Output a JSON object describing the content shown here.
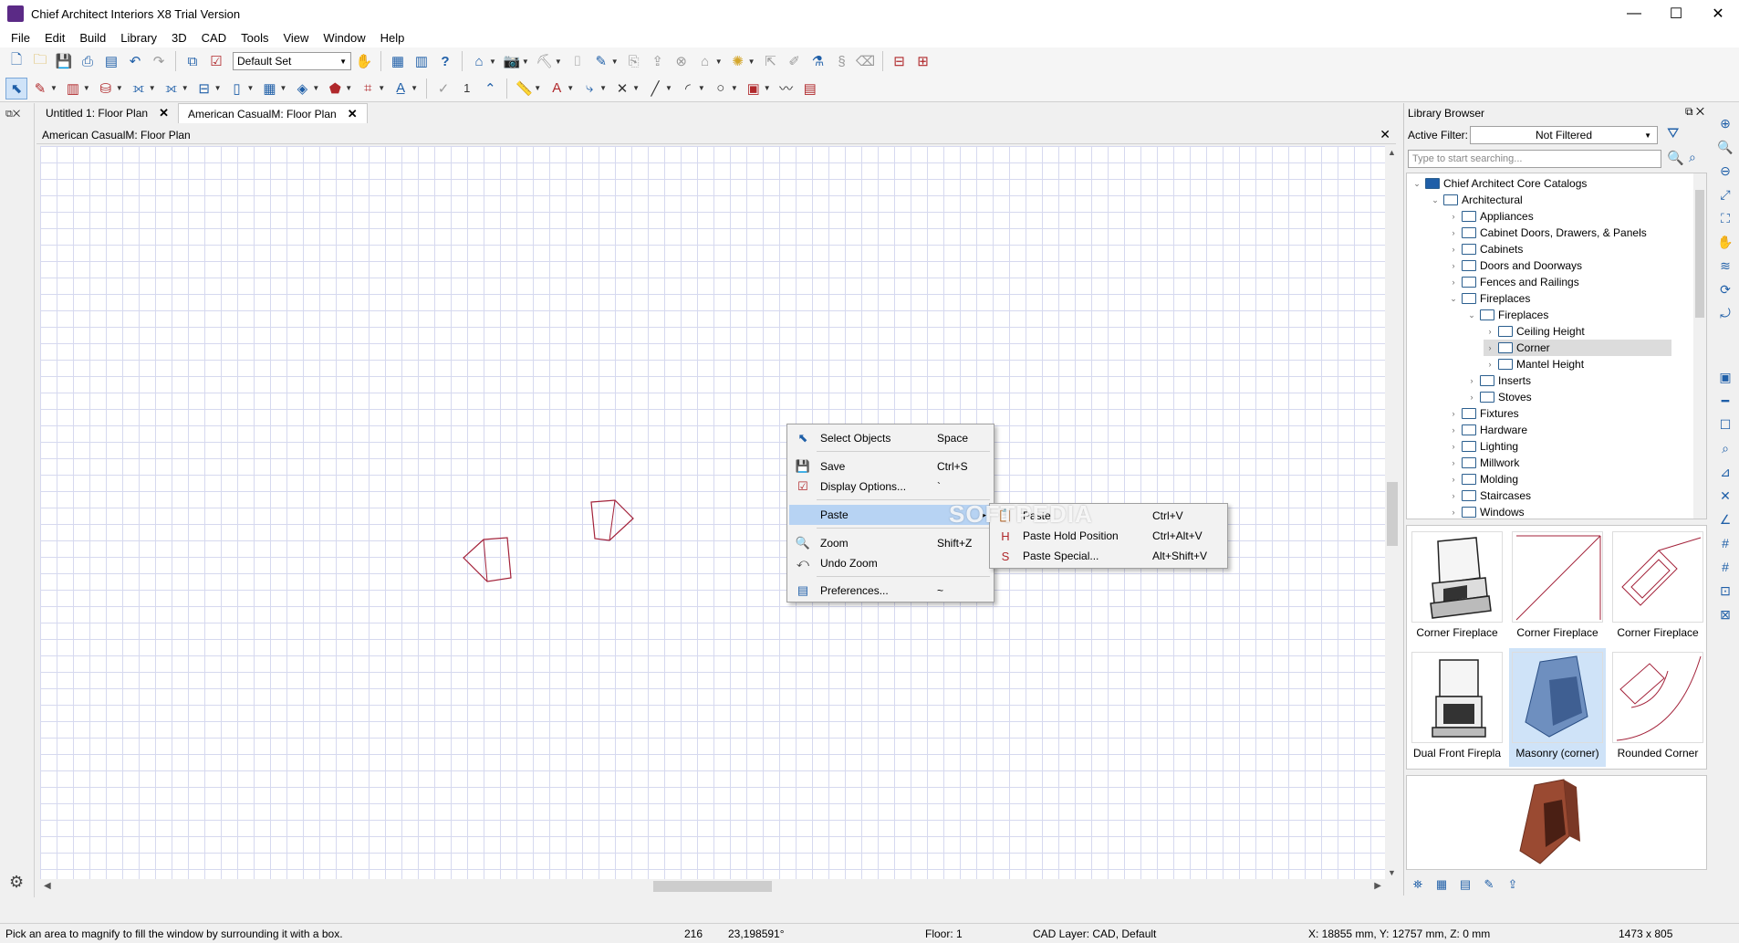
{
  "window": {
    "title": "Chief Architect Interiors X8 Trial Version",
    "minimize": "—",
    "maximize": "☐",
    "close": "✕"
  },
  "menu": [
    "File",
    "Edit",
    "Build",
    "Library",
    "3D",
    "CAD",
    "Tools",
    "View",
    "Window",
    "Help"
  ],
  "toolbar": {
    "layer_set": "Default Set",
    "number_field": "1"
  },
  "tabs": [
    {
      "label": "Untitled 1: Floor Plan",
      "close": "✕"
    },
    {
      "label": "American CasualM: Floor Plan",
      "close": "✕"
    }
  ],
  "view": {
    "header": "American CasualM: Floor Plan",
    "close": "✕"
  },
  "context_menu": {
    "items": [
      {
        "label": "Select Objects",
        "shortcut": "Space",
        "icon": "select-objects-icon"
      },
      {
        "label": "Save",
        "shortcut": "Ctrl+S",
        "icon": "save-icon"
      },
      {
        "label": "Display Options...",
        "shortcut": "`",
        "icon": "display-options-icon"
      },
      {
        "label": "Paste",
        "shortcut": "",
        "icon": "",
        "arrow": "▸"
      },
      {
        "label": "Zoom",
        "shortcut": "Shift+Z",
        "icon": "zoom-icon"
      },
      {
        "label": "Undo Zoom",
        "shortcut": "",
        "icon": "undo-zoom-icon"
      },
      {
        "label": "Preferences...",
        "shortcut": "~",
        "icon": "preferences-icon"
      }
    ],
    "submenu": [
      {
        "label": "Paste",
        "shortcut": "Ctrl+V"
      },
      {
        "label": "Paste Hold Position",
        "shortcut": "Ctrl+Alt+V"
      },
      {
        "label": "Paste Special...",
        "shortcut": "Alt+Shift+V"
      }
    ],
    "watermark": "SOFTPEDIA"
  },
  "library": {
    "title": "Library Browser",
    "filter_label": "Active Filter:",
    "filter_value": "Not Filtered",
    "search_placeholder": "Type to start searching...",
    "tree": [
      {
        "label": "Chief Architect Core Catalogs",
        "expanded": "⌄"
      },
      {
        "label": "Architectural",
        "expanded": "⌄"
      },
      {
        "label": "Appliances",
        "expanded": "›"
      },
      {
        "label": "Cabinet Doors, Drawers, & Panels",
        "expanded": "›"
      },
      {
        "label": "Cabinets",
        "expanded": "›"
      },
      {
        "label": "Doors and Doorways",
        "expanded": "›"
      },
      {
        "label": "Fences and Railings",
        "expanded": "›"
      },
      {
        "label": "Fireplaces",
        "expanded": "⌄"
      },
      {
        "label": "Fireplaces",
        "expanded": "⌄"
      },
      {
        "label": "Ceiling Height",
        "expanded": "›"
      },
      {
        "label": "Corner",
        "expanded": "›"
      },
      {
        "label": "Mantel Height",
        "expanded": "›"
      },
      {
        "label": "Inserts",
        "expanded": "›"
      },
      {
        "label": "Stoves",
        "expanded": "›"
      },
      {
        "label": "Fixtures",
        "expanded": "›"
      },
      {
        "label": "Hardware",
        "expanded": "›"
      },
      {
        "label": "Lighting",
        "expanded": "›"
      },
      {
        "label": "Millwork",
        "expanded": "›"
      },
      {
        "label": "Molding",
        "expanded": "›"
      },
      {
        "label": "Staircases",
        "expanded": "›"
      },
      {
        "label": "Windows",
        "expanded": "›"
      }
    ],
    "thumbnails": [
      "Corner Fireplace",
      "Corner Fireplace",
      "Corner Fireplace",
      "Dual Front Firepla",
      "Masonry (corner)",
      "Rounded Corner"
    ]
  },
  "status": {
    "message": "Pick an area to magnify to fill the window by surrounding it with a box.",
    "count": "216",
    "angle": "23,198591°",
    "floor": "Floor: 1",
    "cad_layer": "CAD Layer: CAD,  Default",
    "coords": "X: 18855 mm, Y: 12757 mm, Z: 0 mm",
    "size": "1473 x 805"
  },
  "colors": {
    "accent": "#1f5fa8",
    "highlight": "#b7d3f3",
    "drawing_line": "#a3223a",
    "grid": "#d6d9ef"
  }
}
